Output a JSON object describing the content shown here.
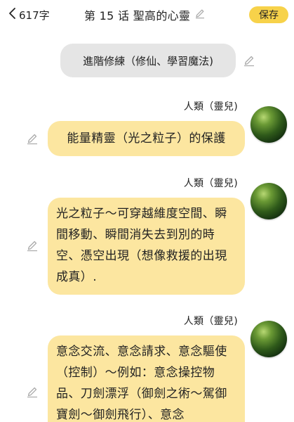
{
  "header": {
    "back_icon": "chevron-left-icon",
    "word_count": "617字",
    "title": "第 15 话  聖高的心靈",
    "edit_icon": "pencil-icon",
    "save_label": "保存"
  },
  "chapter": {
    "label": "進階修練（修仙、學習魔法)",
    "edit_icon": "pencil-icon"
  },
  "messages": [
    {
      "speaker": "人類（靈兒)",
      "text": "能量精靈（光之粒子）的保護",
      "avatar": "green-sphere-avatar"
    },
    {
      "speaker": "人類（靈兒)",
      "text": "光之粒子～可穿越維度空間、瞬間移動、瞬間消失去到別的時空、憑空出現（想像救援的出現成真）.",
      "avatar": "green-sphere-avatar"
    },
    {
      "speaker": "人類（靈兒)",
      "text": "意念交流、意念請求、意念驅使（控制）～例如：意念操控物品、刀劍漂浮（御劍之術～駕御寶劍～御劍飛行）、意念",
      "avatar": "green-sphere-avatar"
    }
  ],
  "colors": {
    "accent": "#f7d24a",
    "bubble": "#fce6a0",
    "chapter_pill": "#e5e5e5"
  }
}
